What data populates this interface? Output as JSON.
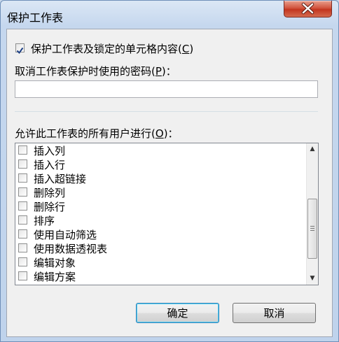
{
  "window": {
    "title": "保护工作表"
  },
  "protect": {
    "label": "保护工作表及锁定的单元格内容",
    "hotkey": "C",
    "checked": true
  },
  "password": {
    "label": "取消工作表保护时使用的密码",
    "hotkey": "P",
    "suffix": "：",
    "value": ""
  },
  "allow": {
    "label": "允许此工作表的所有用户进行",
    "hotkey": "O",
    "suffix": "："
  },
  "list": {
    "items": [
      {
        "label": "插入列",
        "checked": false
      },
      {
        "label": "插入行",
        "checked": false
      },
      {
        "label": "插入超链接",
        "checked": false
      },
      {
        "label": "删除列",
        "checked": false
      },
      {
        "label": "删除行",
        "checked": false
      },
      {
        "label": "排序",
        "checked": false
      },
      {
        "label": "使用自动筛选",
        "checked": false
      },
      {
        "label": "使用数据透视表",
        "checked": false
      },
      {
        "label": "编辑对象",
        "checked": false
      },
      {
        "label": "编辑方案",
        "checked": false
      }
    ],
    "scroll_position": 0.75
  },
  "buttons": {
    "ok": "确定",
    "cancel": "取消"
  },
  "icons": {
    "close": "close-icon",
    "scroll_up": "scroll-up-arrow-icon",
    "scroll_down": "scroll-down-arrow-icon",
    "check": "checkmark-icon"
  }
}
